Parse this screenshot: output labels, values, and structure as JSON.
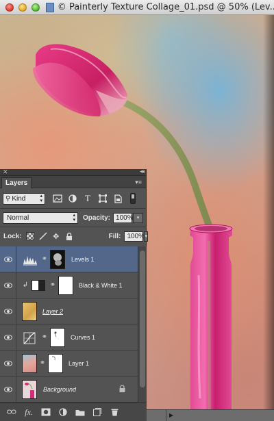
{
  "window": {
    "title": "© Painterly Texture Collage_01.psd @ 50% (Lev..."
  },
  "panel": {
    "tab_label": "Layers",
    "filter": {
      "kind_label": "Kind",
      "icons": [
        "pixel-layer-filter-icon",
        "adjustment-layer-filter-icon",
        "type-layer-filter-icon",
        "shape-layer-filter-icon",
        "smart-object-filter-icon"
      ]
    },
    "blend_mode": "Normal",
    "opacity_label": "Opacity:",
    "opacity_value": "100%",
    "lock_label": "Lock:",
    "fill_label": "Fill:",
    "fill_value": "100%",
    "layers": [
      {
        "name": "Levels 1",
        "selected": true
      },
      {
        "name": "Black & White 1",
        "selected": false
      },
      {
        "name": "Layer 2",
        "selected": false
      },
      {
        "name": "Curves 1",
        "selected": false
      },
      {
        "name": "Layer 1",
        "selected": false
      },
      {
        "name": "Background",
        "selected": false
      }
    ]
  },
  "colors": {
    "panel_bg": "#535353",
    "selected_layer": "#52678a",
    "tulip": "#d6246e",
    "bottle": "#d42a7a"
  }
}
